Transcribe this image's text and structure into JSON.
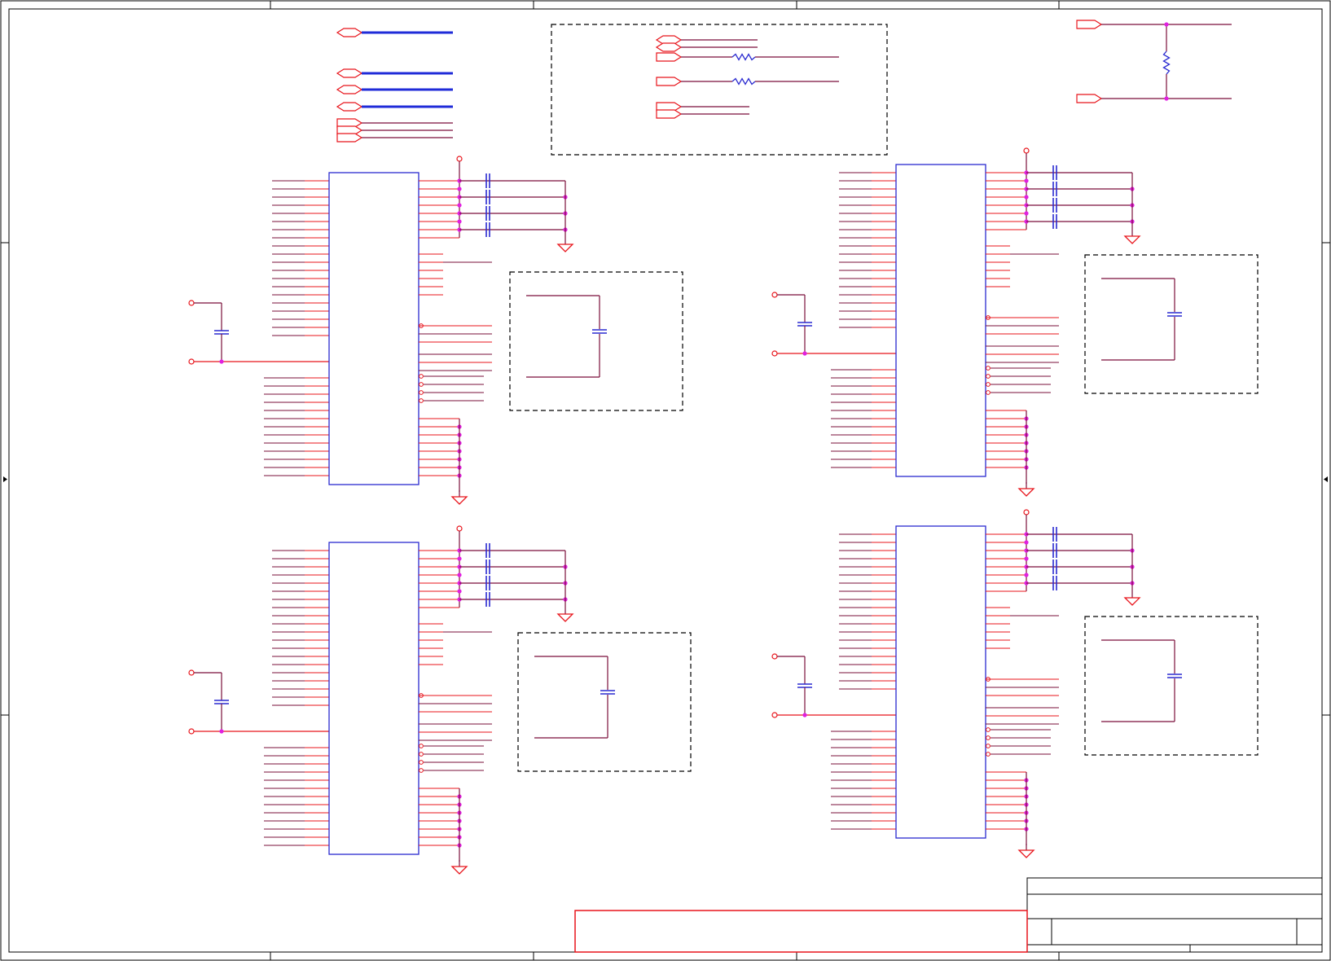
{
  "colors": {
    "frame": "#000000",
    "pin": "#e8141b",
    "net": "#7a0f3a",
    "bus": "#1f2bd8",
    "part": "#2a2ad0",
    "junction": "#e020e0",
    "port": "#e8141b",
    "group_box": "#000000"
  },
  "icons": {
    "port": "port-icon",
    "ground": "ground-symbol-icon",
    "power": "power-terminal-icon",
    "capacitor": "capacitor-icon",
    "resistor": "resistor-icon",
    "junction": "junction-dot-icon"
  },
  "schematic": {
    "sheet_text": "",
    "component_count": 4,
    "bus_count": 4
  }
}
